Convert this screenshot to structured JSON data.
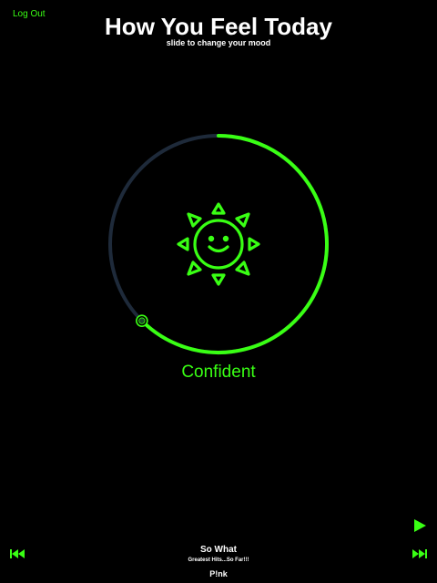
{
  "header": {
    "logout_label": "Log Out",
    "title": "How You Feel Today",
    "subtitle": "slide to change your mood"
  },
  "mood": {
    "label": "Confident",
    "slider_value_fraction": 0.625,
    "icon": "smiling-sun-icon"
  },
  "player": {
    "song_title": "So What",
    "album": "Greatest Hits...So Far!!!",
    "artist": "P!nk",
    "play_icon": "play-icon",
    "prev_icon": "skip-back-icon",
    "next_icon": "skip-forward-icon"
  },
  "colors": {
    "background": "#000000",
    "accent": "#39ff14",
    "track": "#1e2a3a",
    "text": "#ffffff"
  }
}
